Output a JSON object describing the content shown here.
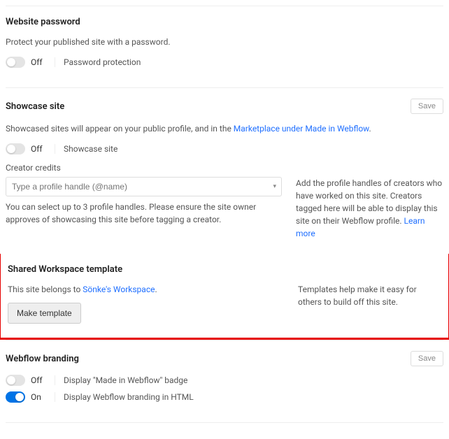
{
  "password": {
    "title": "Website password",
    "desc": "Protect your published site with a password.",
    "toggleState": "Off",
    "toggleLabel": "Password protection"
  },
  "showcase": {
    "title": "Showcase site",
    "saveBtn": "Save",
    "descPrefix": "Showcased sites will appear on your public profile, and in the ",
    "descLink": "Marketplace under Made in Webflow",
    "descSuffix": ".",
    "toggleState": "Off",
    "toggleLabel": "Showcase site",
    "creditsLabel": "Creator credits",
    "handlePlaceholder": "Type a profile handle (@name)",
    "helper": "You can select up to 3 profile handles. Please ensure the site owner approves of showcasing this site before tagging a creator.",
    "sideText": "Add the profile handles of creators who have worked on this site. Creators tagged here will be able to display this site on their Webflow profile. ",
    "sideLink": "Learn more"
  },
  "template": {
    "title": "Shared Workspace template",
    "belongsPrefix": "This site belongs to ",
    "belongsLink": "Sönke's Workspace",
    "belongsSuffix": ".",
    "btn": "Make template",
    "sideText": "Templates help make it easy for others to build off this site."
  },
  "branding": {
    "title": "Webflow branding",
    "saveBtn": "Save",
    "row1State": "Off",
    "row1Label": "Display \"Made in Webflow\" badge",
    "row2State": "On",
    "row2Label": "Display Webflow branding in HTML"
  }
}
